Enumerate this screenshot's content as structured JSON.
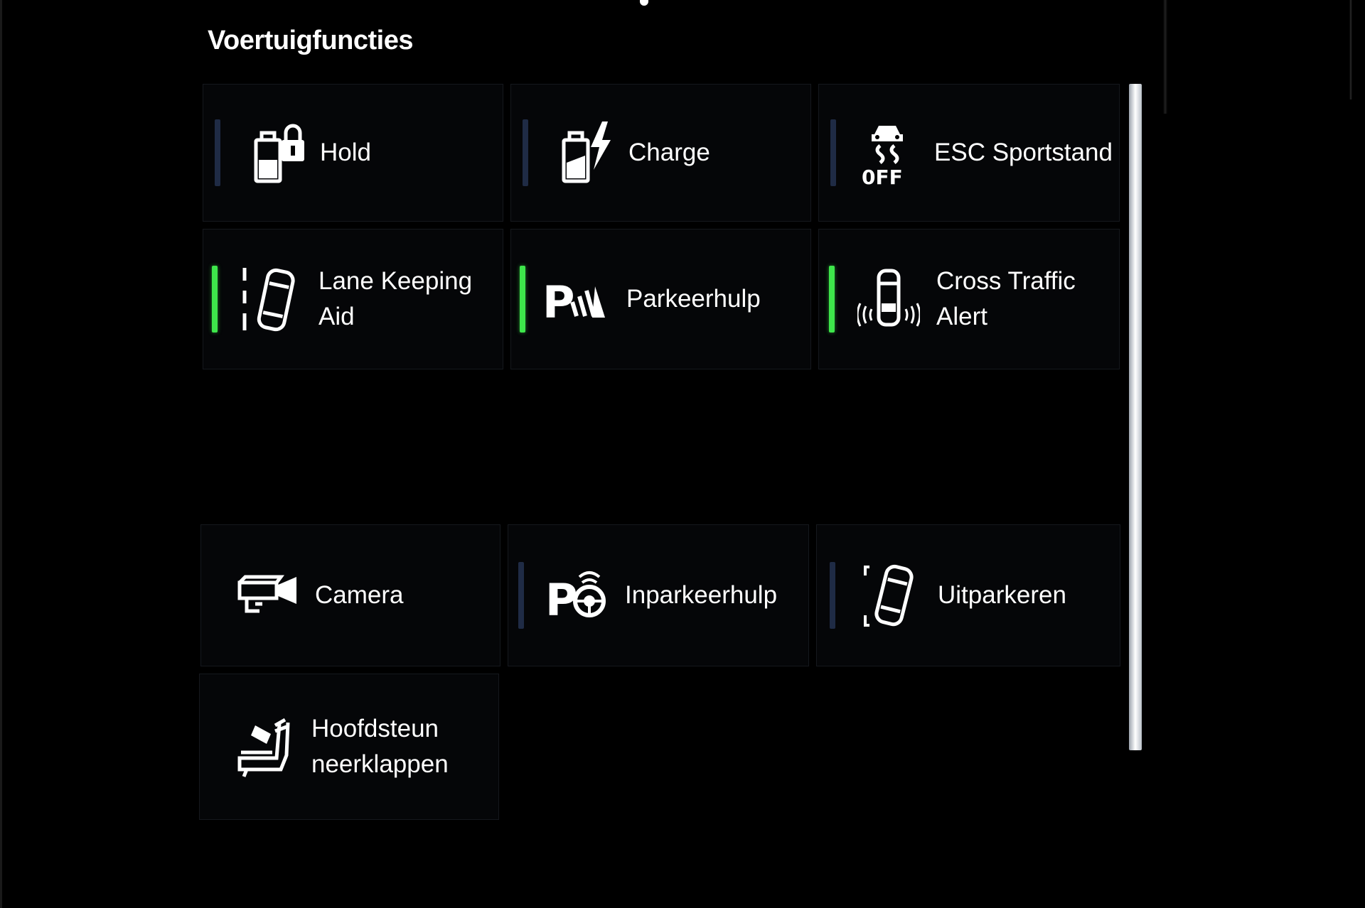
{
  "page": {
    "title": "Voertuigfuncties"
  },
  "colors": {
    "background": "#000000",
    "tile": "#050608",
    "indicator_off": "#1f2b45",
    "indicator_on": "#3ee64b",
    "text": "#ffffff"
  },
  "tiles": [
    {
      "label": "Hold",
      "icon": "battery-lock-icon",
      "indicator": "off"
    },
    {
      "label": "Charge",
      "icon": "battery-charge-icon",
      "indicator": "off"
    },
    {
      "label": "ESC Sportstand",
      "icon": "esc-off-icon",
      "indicator": "off"
    },
    {
      "label": "Lane Keeping Aid",
      "icon": "lane-keeping-icon",
      "indicator": "on"
    },
    {
      "label": "Parkeerhulp",
      "icon": "park-assist-icon",
      "indicator": "on"
    },
    {
      "label": "Cross Traffic Alert",
      "icon": "cross-traffic-icon",
      "indicator": "on"
    },
    {
      "label": "Camera",
      "icon": "camera-icon",
      "indicator": "none"
    },
    {
      "label": "Inparkeerhulp",
      "icon": "park-steering-icon",
      "indicator": "off"
    },
    {
      "label": "Uitparkeren",
      "icon": "park-out-icon",
      "indicator": "off"
    },
    {
      "label": "Hoofdsteun neerklappen",
      "icon": "headrest-icon",
      "indicator": "none"
    }
  ]
}
